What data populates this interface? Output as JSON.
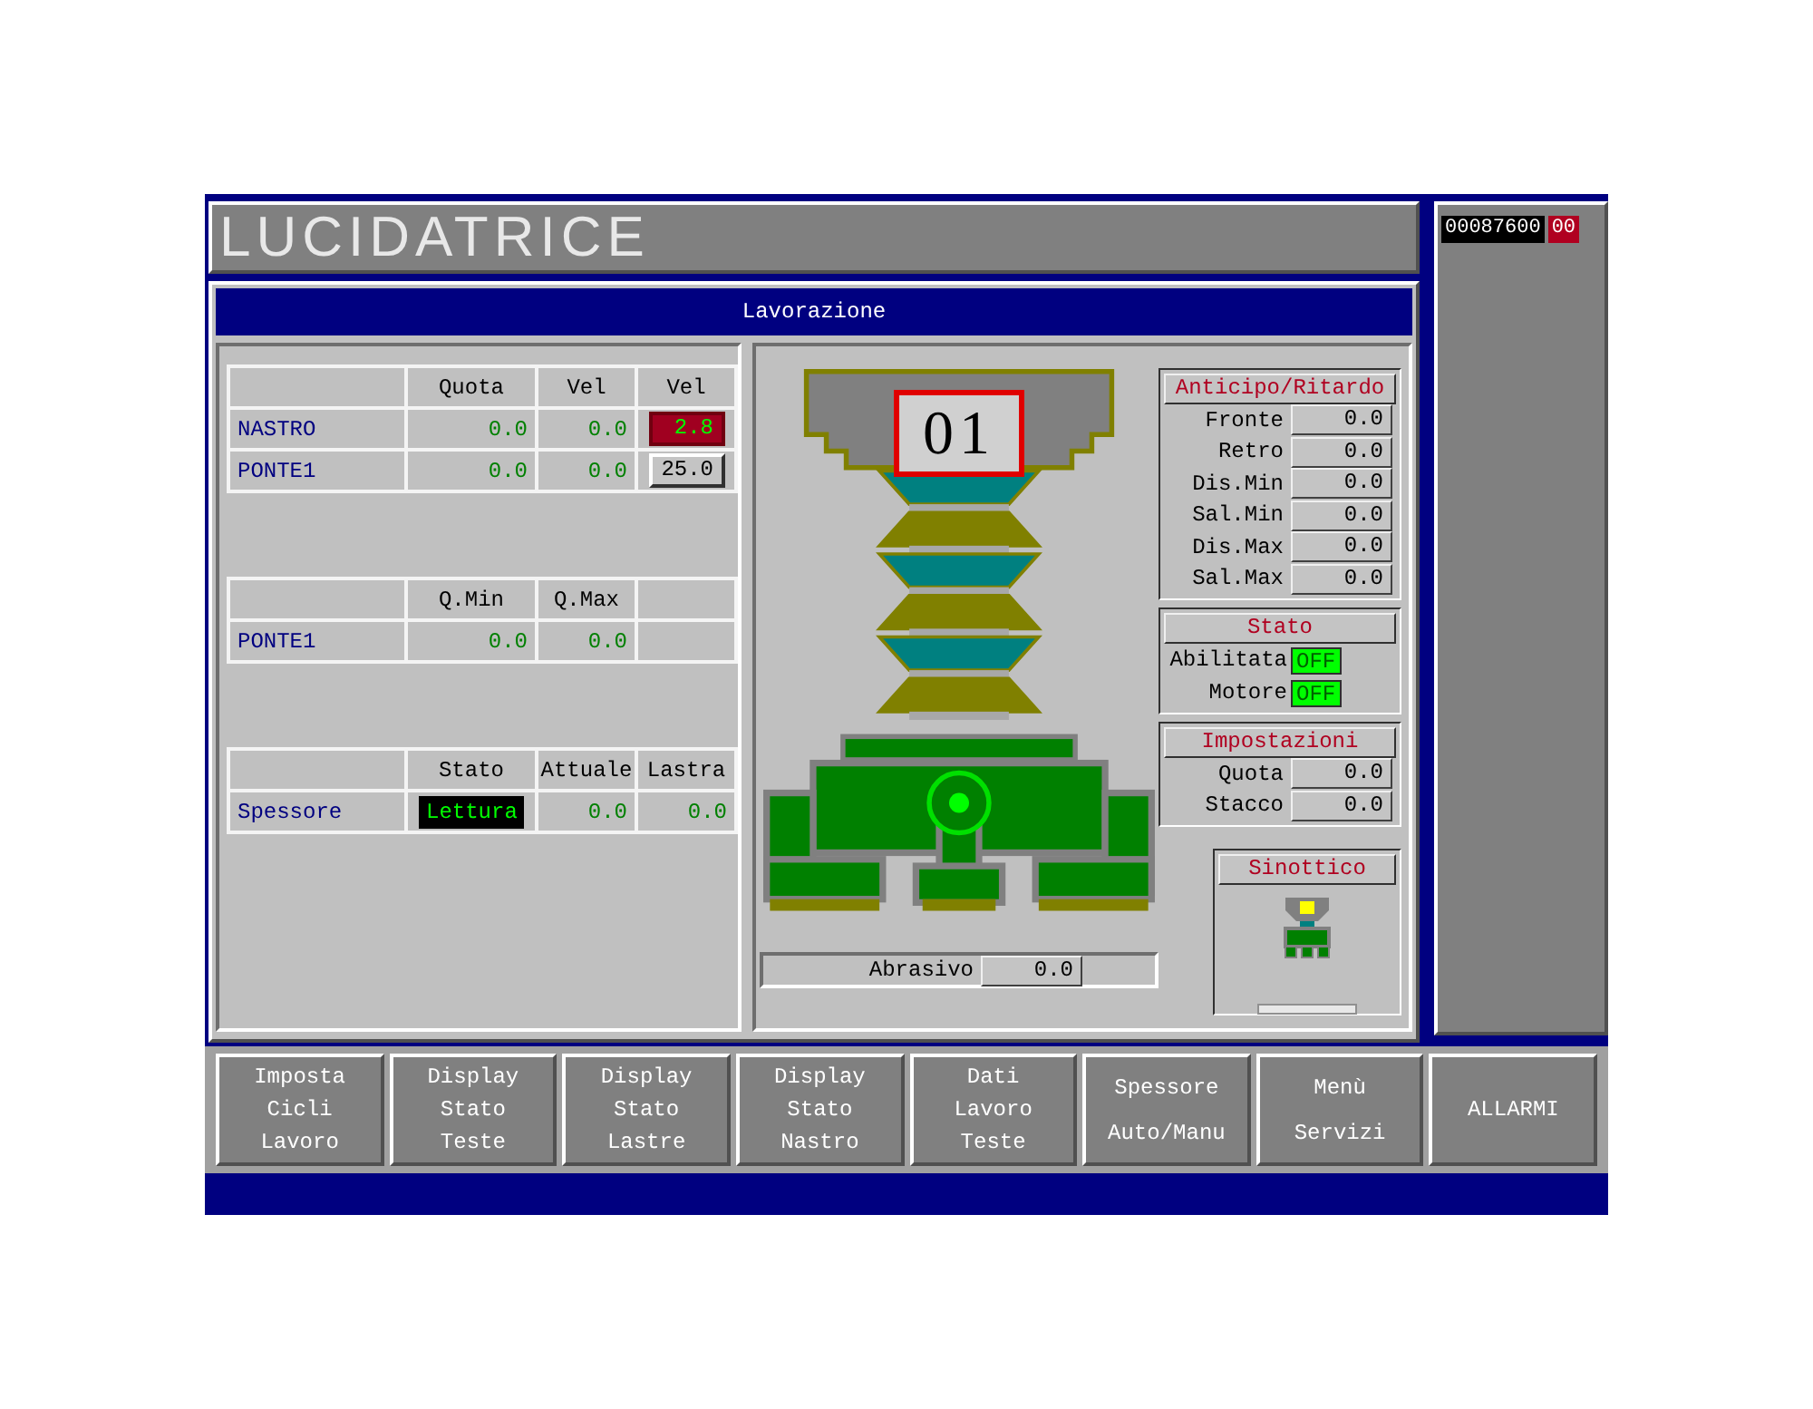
{
  "title": "LUCIDATRICE",
  "counter": {
    "value": "00087600",
    "code": "00"
  },
  "panel": {
    "title": "Lavorazione"
  },
  "axes_table": {
    "columns": [
      "Quota",
      "Vel",
      "Vel"
    ],
    "rows": [
      {
        "label": "NASTRO",
        "values": [
          "0.0",
          "0.0"
        ],
        "setpoint": "2.8",
        "editing": true
      },
      {
        "label": "PONTE1",
        "values": [
          "0.0",
          "0.0"
        ],
        "setpoint": "25.0",
        "editing": false
      }
    ]
  },
  "limits_table": {
    "columns": [
      "Q.Min",
      "Q.Max"
    ],
    "rows": [
      {
        "label": "PONTE1",
        "values": [
          "0.0",
          "0.0"
        ]
      }
    ]
  },
  "thickness_table": {
    "columns": [
      "Stato",
      "Attuale",
      "Lastra"
    ],
    "rows": [
      {
        "label": "Spessore",
        "state": "Lettura",
        "values": [
          "0.0",
          "0.0"
        ]
      }
    ]
  },
  "head_number": "01",
  "anticipo": {
    "title": "Anticipo/Ritardo",
    "fields": [
      {
        "label": "Fronte",
        "value": "0.0"
      },
      {
        "label": "Retro",
        "value": "0.0"
      },
      {
        "label": "Dis.Min",
        "value": "0.0"
      },
      {
        "label": "Sal.Min",
        "value": "0.0"
      },
      {
        "label": "Dis.Max",
        "value": "0.0"
      },
      {
        "label": "Sal.Max",
        "value": "0.0"
      }
    ]
  },
  "stato": {
    "title": "Stato",
    "items": [
      {
        "label": "Abilitata",
        "value": "OFF",
        "on": false
      },
      {
        "label": "Motore",
        "value": "OFF",
        "on": false
      }
    ]
  },
  "impostazioni": {
    "title": "Impostazioni",
    "fields": [
      {
        "label": "Quota",
        "value": "0.0"
      },
      {
        "label": "Stacco",
        "value": "0.0"
      }
    ]
  },
  "sinottico": {
    "title": "Sinottico"
  },
  "abrasivo": {
    "label": "Abrasivo",
    "value": "0.0"
  },
  "buttons": [
    {
      "lines": [
        "Imposta",
        "Cicli",
        "Lavoro"
      ]
    },
    {
      "lines": [
        "Display",
        "Stato",
        "Teste"
      ]
    },
    {
      "lines": [
        "Display",
        "Stato",
        "Lastre"
      ]
    },
    {
      "lines": [
        "Display",
        "Stato",
        "Nastro"
      ]
    },
    {
      "lines": [
        "Dati",
        "Lavoro",
        "Teste"
      ]
    },
    {
      "lines": [
        "Spessore",
        "Auto/Manu"
      ]
    },
    {
      "lines": [
        "Menù",
        "Servizi"
      ]
    },
    {
      "lines": [
        "ALLARMI"
      ]
    }
  ]
}
